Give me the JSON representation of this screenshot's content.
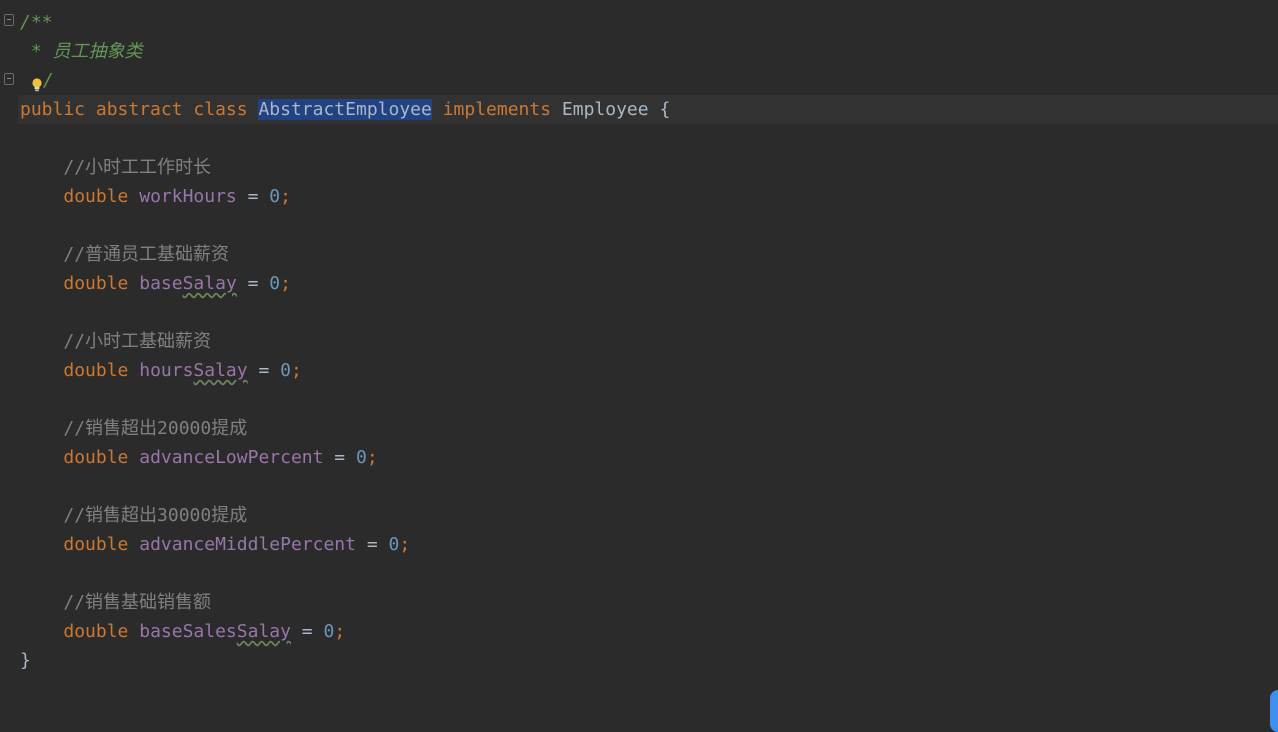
{
  "editor": {
    "doc_open": "/**",
    "doc_text": " * 员工抽象类",
    "doc_close": "/",
    "class_decl": {
      "kw_public": "public",
      "kw_abstract": "abstract",
      "kw_class": "class",
      "class_name": "AbstractEmployee",
      "kw_implements": "implements",
      "interface_name": "Employee",
      "brace_open": " {"
    },
    "fields": [
      {
        "comment": "//小时工工作时长",
        "type": "double",
        "name_plain": "workHours",
        "name_typo": "",
        "eq": " = ",
        "value": "0",
        "semi": ";"
      },
      {
        "comment": "//普通员工基础薪资",
        "type": "double",
        "name_plain": "base",
        "name_typo": "Salay",
        "eq": " = ",
        "value": "0",
        "semi": ";"
      },
      {
        "comment": "//小时工基础薪资",
        "type": "double",
        "name_plain": "hours",
        "name_typo": "Salay",
        "eq": " = ",
        "value": "0",
        "semi": ";"
      },
      {
        "comment": "//销售超出20000提成",
        "type": "double",
        "name_plain": "advanceLowPercent",
        "name_typo": "",
        "eq": " = ",
        "value": "0",
        "semi": ";"
      },
      {
        "comment": "//销售超出30000提成",
        "type": "double",
        "name_plain": "advanceMiddlePercent",
        "name_typo": "",
        "eq": " = ",
        "value": "0",
        "semi": ";"
      },
      {
        "comment": "//销售基础销售额",
        "type": "double",
        "name_plain": "baseSales",
        "name_typo": "Salay",
        "eq": " = ",
        "value": "0",
        "semi": ";"
      }
    ],
    "brace_close": "}"
  },
  "colors": {
    "background": "#2b2b2b",
    "keyword": "#cc7832",
    "javadoc": "#629755",
    "comment": "#808080",
    "field": "#9876aa",
    "number": "#6897bb",
    "selection": "#214283"
  },
  "icons": {
    "fold_marker": "fold-icon",
    "intention": "lightbulb-icon"
  }
}
